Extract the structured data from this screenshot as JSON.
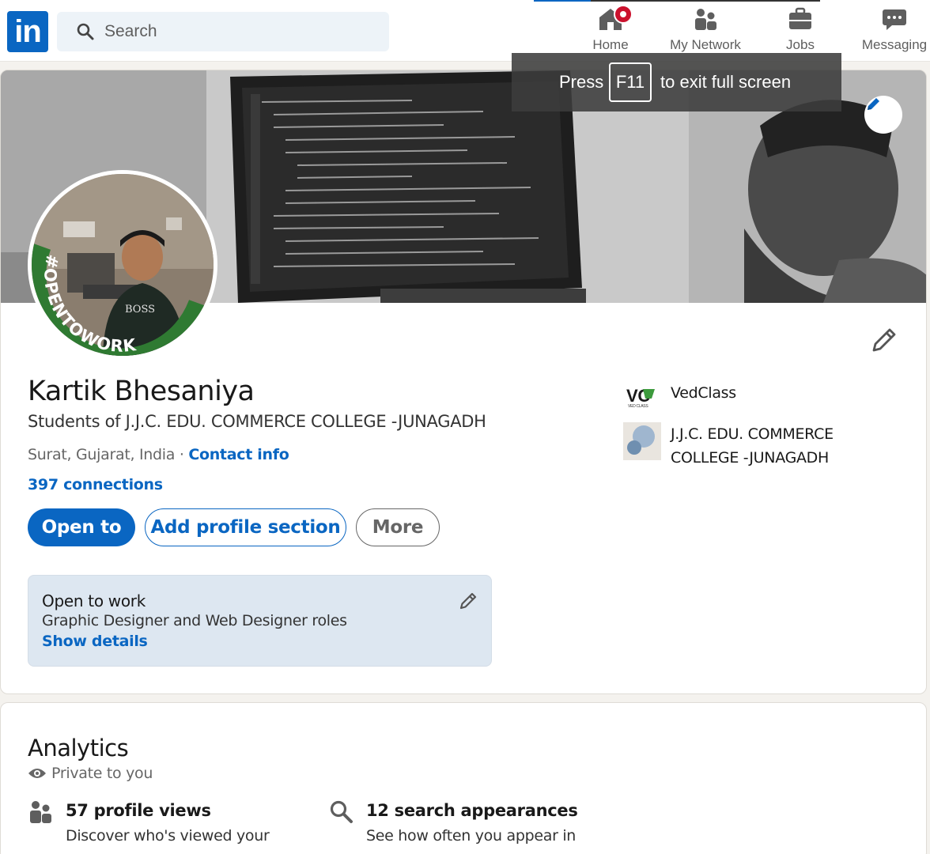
{
  "nav": {
    "logo": "in",
    "search_placeholder": "Search",
    "items": [
      {
        "label": "Home",
        "icon": "home-icon",
        "active": true,
        "badge": true
      },
      {
        "label": "My Network",
        "icon": "people-icon"
      },
      {
        "label": "Jobs",
        "icon": "briefcase-icon"
      },
      {
        "label": "Messaging",
        "icon": "chat-icon"
      }
    ]
  },
  "toast": {
    "press": "Press",
    "key": "F11",
    "message": "to exit full screen"
  },
  "profile": {
    "name": "Kartik Bhesaniya",
    "headline": "Students of J.J.C. EDU. COMMERCE COLLEGE -JUNAGADH",
    "location": "Surat, Gujarat, India",
    "separator": " · ",
    "contact_info": "Contact info",
    "connections": "397 connections",
    "open_to_work_frame": "#OPENTOWORK",
    "photo_shirt_text": "BOSS",
    "buttons": {
      "open_to": "Open to",
      "add_section": "Add profile section",
      "more": "More"
    },
    "open_to_work": {
      "title": "Open to work",
      "roles": "Graphic Designer and Web Designer roles",
      "link": "Show details"
    },
    "experience": [
      {
        "name": "VedClass",
        "logo_text": "VC",
        "logo_subtext": "VED CLASS"
      },
      {
        "name_line1": "J.J.C. EDU. COMMERCE",
        "name_line2": "COLLEGE -JUNAGADH"
      }
    ]
  },
  "analytics": {
    "title": "Analytics",
    "privacy": "Private to you",
    "stats": [
      {
        "title": "57 profile views",
        "subtitle": "Discover who's viewed your",
        "icon": "people-icon"
      },
      {
        "title": "12 search appearances",
        "subtitle": "See how often you appear in",
        "icon": "search-icon"
      }
    ]
  },
  "colors": {
    "brand": "#0a66c2",
    "opentowork_green": "#2f7a32",
    "badge_red": "#cb112d",
    "open_to_work_bg": "#dde7f1"
  }
}
